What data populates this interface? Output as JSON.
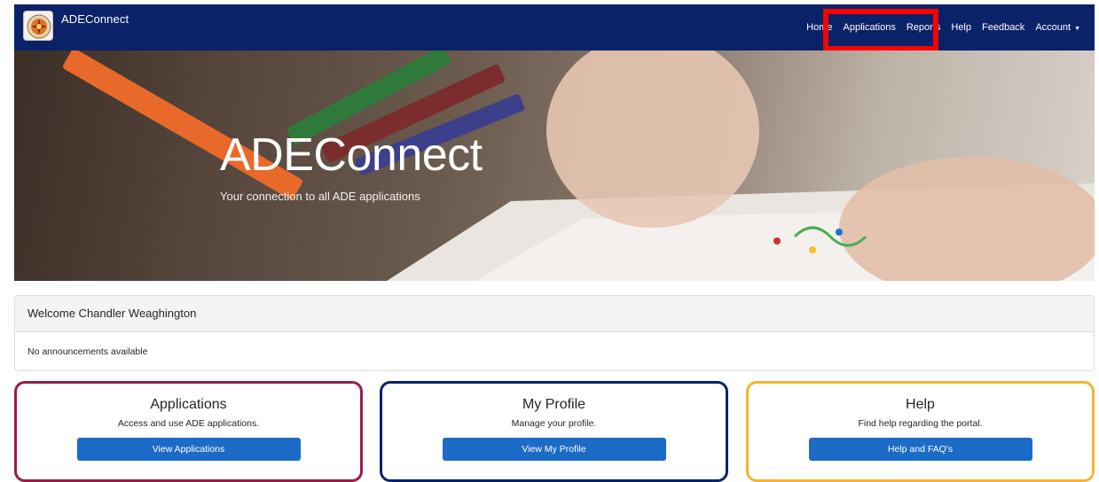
{
  "navbar": {
    "brand": "ADEConnect",
    "links": [
      {
        "label": "Home"
      },
      {
        "label": "Applications"
      },
      {
        "label": "Reports"
      },
      {
        "label": "Help"
      },
      {
        "label": "Feedback"
      },
      {
        "label": "Account"
      }
    ],
    "color": "#0a2268"
  },
  "hero": {
    "title": "ADEConnect",
    "subtitle": "Your connection to all ADE applications"
  },
  "welcome": {
    "heading": "Welcome Chandler Weaghington",
    "body": "No announcements available"
  },
  "cards": [
    {
      "title": "Applications",
      "description": "Access and use ADE applications.",
      "button": "View Applications",
      "border_color": "#9b1c46"
    },
    {
      "title": "My Profile",
      "description": "Manage your profile.",
      "button": "View My Profile",
      "border_color": "#0a2268"
    },
    {
      "title": "Help",
      "description": "Find help regarding the portal.",
      "button": "Help and FAQ's",
      "border_color": "#f2b632"
    }
  ],
  "annotation": {
    "highlight_color": "#ff0000"
  }
}
